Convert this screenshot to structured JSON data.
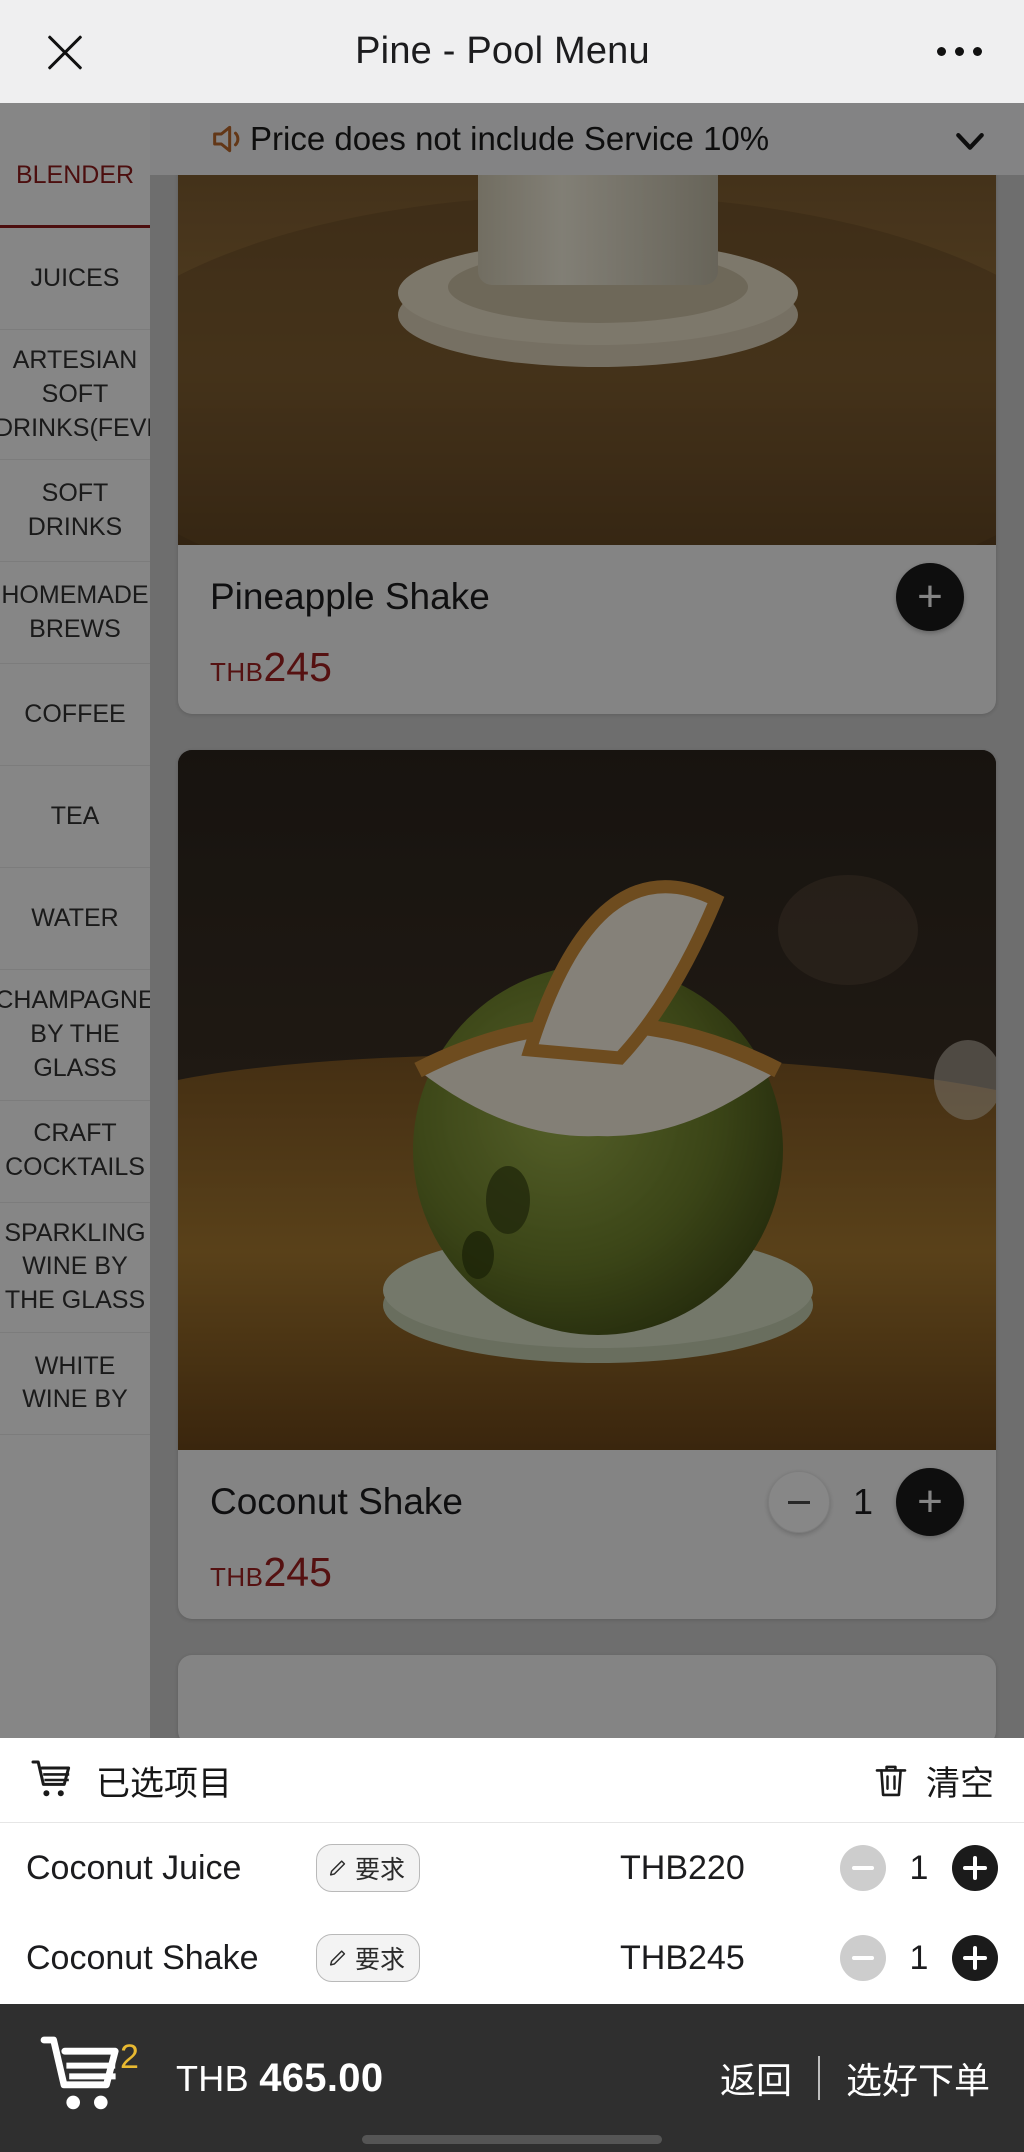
{
  "titlebar": {
    "title": "Pine - Pool Menu",
    "close_icon": "close-icon",
    "more_icon": "more-options-icon"
  },
  "notice": {
    "text": "Price does not include Service 10%",
    "speaker_icon": "speaker-icon",
    "chevron_icon": "chevron-down-icon"
  },
  "sidebar": {
    "items": [
      {
        "label": "BLENDER",
        "active": true
      },
      {
        "label": "JUICES",
        "active": false
      },
      {
        "label": "ARTESIAN SOFT DRINKS(FEVE",
        "active": false
      },
      {
        "label": "SOFT DRINKS",
        "active": false
      },
      {
        "label": "HOMEMADE BREWS",
        "active": false
      },
      {
        "label": "COFFEE",
        "active": false
      },
      {
        "label": "TEA",
        "active": false
      },
      {
        "label": "WATER",
        "active": false
      },
      {
        "label": "CHAMPAGNE BY THE GLASS",
        "active": false
      },
      {
        "label": "CRAFT COCKTAILS",
        "active": false
      },
      {
        "label": "SPARKLING WINE BY THE GLASS",
        "active": false
      },
      {
        "label": "WHITE WINE BY",
        "active": false
      }
    ]
  },
  "menu": {
    "items": [
      {
        "name": "Pineapple Shake",
        "currency": "THB",
        "price": "245",
        "has_stepper": false,
        "qty": "",
        "photo": "pineapple-shake-photo"
      },
      {
        "name": "Coconut Shake",
        "currency": "THB",
        "price": "245",
        "has_stepper": true,
        "qty": "1",
        "photo": "coconut-shake-photo"
      }
    ]
  },
  "cart_sheet": {
    "title": "已选项目",
    "cart_icon": "shopping-cart-icon",
    "clear_label": "清空",
    "trash_icon": "trash-icon",
    "rows": [
      {
        "name": "Coconut Juice",
        "request_label": "要求",
        "price": "THB220",
        "qty": "1"
      },
      {
        "name": "Coconut Shake",
        "request_label": "要求",
        "price": "THB245",
        "qty": "1"
      }
    ]
  },
  "bottom_bar": {
    "cart_icon": "shopping-cart-icon",
    "badge": "2",
    "currency": "THB",
    "total": "465.00",
    "back_label": "返回",
    "order_label": "选好下单"
  },
  "colors": {
    "accent_red": "#9b2020",
    "badge_yellow": "#e8b931",
    "bottom_bar": "#2f2f2f"
  }
}
